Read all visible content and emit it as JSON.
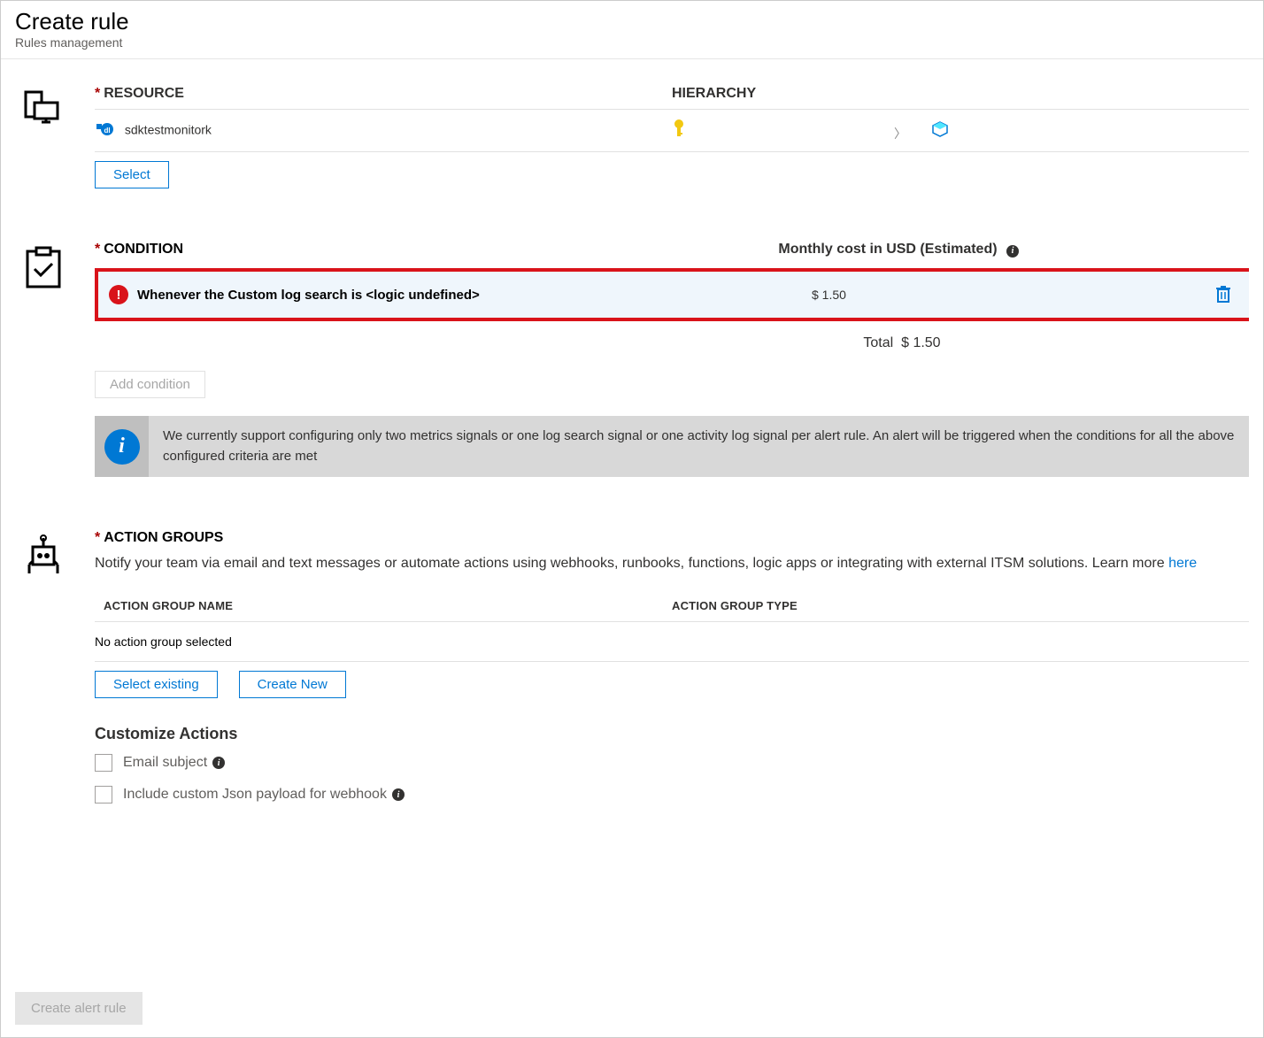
{
  "header": {
    "title": "Create rule",
    "subtitle": "Rules management"
  },
  "resource": {
    "section_label": "RESOURCE",
    "hierarchy_label": "HIERARCHY",
    "resource_name": "sdktestmonitork",
    "select_btn": "Select"
  },
  "condition": {
    "section_label": "CONDITION",
    "cost_label": "Monthly cost in USD (Estimated)",
    "condition_text": "Whenever the Custom log search is <logic undefined>",
    "cost_value": "$ 1.50",
    "total_label": "Total",
    "total_value": "$ 1.50",
    "add_btn": "Add condition",
    "info_text": "We currently support configuring only two metrics signals or one log search signal or one activity log signal per alert rule. An alert will be triggered when the conditions for all the above configured criteria are met"
  },
  "action_groups": {
    "section_label": "ACTION GROUPS",
    "description": "Notify your team via email and text messages or automate actions using webhooks, runbooks, functions, logic apps or integrating with external ITSM solutions. Learn more ",
    "learn_more": "here",
    "col_name": "ACTION GROUP NAME",
    "col_type": "ACTION GROUP TYPE",
    "empty_text": "No action group selected",
    "select_existing_btn": "Select existing",
    "create_new_btn": "Create New",
    "customize_title": "Customize Actions",
    "email_subject_label": "Email subject",
    "webhook_payload_label": "Include custom Json payload for webhook"
  },
  "footer": {
    "create_btn": "Create alert rule"
  }
}
